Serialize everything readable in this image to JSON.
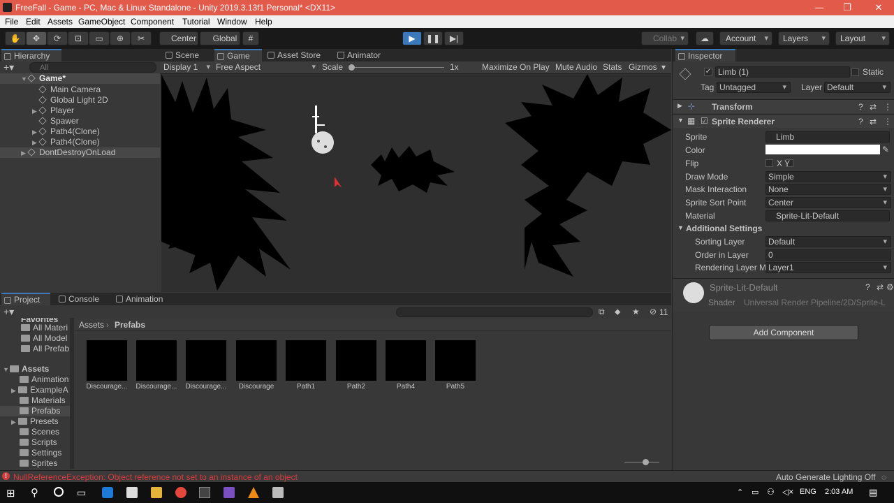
{
  "window": {
    "title": "FreeFall - Game - PC, Mac & Linux Standalone - Unity 2019.3.13f1 Personal* <DX11>"
  },
  "menu": [
    "File",
    "Edit",
    "Assets",
    "GameObject",
    "Component",
    "Tutorial",
    "Window",
    "Help"
  ],
  "toolbar": {
    "pivot": "Center",
    "space": "Global",
    "collab": "Collab",
    "account": "Account",
    "layers": "Layers",
    "layout": "Layout"
  },
  "hierarchy": {
    "tab": "Hierarchy",
    "search_placeholder": "All",
    "scene": "Game*",
    "items": [
      "Main Camera",
      "Global Light 2D",
      "Player",
      "Spawer",
      "Path4(Clone)",
      "Path4(Clone)"
    ],
    "dontdestroy": "DontDestroyOnLoad"
  },
  "center_tabs": [
    "Scene",
    "Game",
    "Asset Store",
    "Animator"
  ],
  "game_toolbar": {
    "display": "Display 1",
    "aspect": "Free Aspect",
    "scale_label": "Scale",
    "scale_value": "1x",
    "maximize": "Maximize On Play",
    "mute": "Mute Audio",
    "stats": "Stats",
    "gizmos": "Gizmos"
  },
  "project": {
    "tabs": [
      "Project",
      "Console",
      "Animation"
    ],
    "favorites": "Favorites",
    "fav_items": [
      "All Materi",
      "All Model",
      "All Prefab"
    ],
    "assets_label": "Assets",
    "folders": [
      "Animation",
      "ExampleA",
      "Materials",
      "Prefabs",
      "Presets",
      "Scenes",
      "Scripts",
      "Settings",
      "Sprites"
    ],
    "breadcrumb": [
      "Assets",
      "Prefabs"
    ],
    "hidden_count": "11",
    "prefabs": [
      "Discourage...",
      "Discourage...",
      "Discourage...",
      "Discourage",
      "Path1",
      "Path2",
      "Path4",
      "Path5"
    ]
  },
  "inspector": {
    "tab": "Inspector",
    "object_name": "Limb (1)",
    "static": "Static",
    "tag_label": "Tag",
    "tag": "Untagged",
    "layer_label": "Layer",
    "layer": "Default",
    "transform": "Transform",
    "sprite_renderer": "Sprite Renderer",
    "fields": [
      {
        "label": "Sprite",
        "value": "Limb"
      },
      {
        "label": "Color",
        "value": ""
      },
      {
        "label": "Flip",
        "value": "X   Y"
      },
      {
        "label": "Draw Mode",
        "value": "Simple"
      },
      {
        "label": "Mask Interaction",
        "value": "None"
      },
      {
        "label": "Sprite Sort Point",
        "value": "Center"
      },
      {
        "label": "Material",
        "value": "Sprite-Lit-Default"
      }
    ],
    "additional": "Additional Settings",
    "add_fields": [
      {
        "label": "Sorting Layer",
        "value": "Default"
      },
      {
        "label": "Order in Layer",
        "value": "0"
      },
      {
        "label": "Rendering Layer M",
        "value": "Layer1"
      }
    ],
    "material_name": "Sprite-Lit-Default",
    "shader_label": "Shader",
    "shader_value": "Universal Render Pipeline/2D/Sprite-L",
    "add_component": "Add Component"
  },
  "status": {
    "error": "NullReferenceException: Object reference not set to an instance of an object",
    "lighting": "Auto Generate Lighting Off"
  },
  "taskbar": {
    "lang": "ENG",
    "time": "2:03 AM"
  },
  "colors": {
    "titlebar": "#e25a4a",
    "accent": "#3a79bb",
    "error": "#d83b3b"
  }
}
